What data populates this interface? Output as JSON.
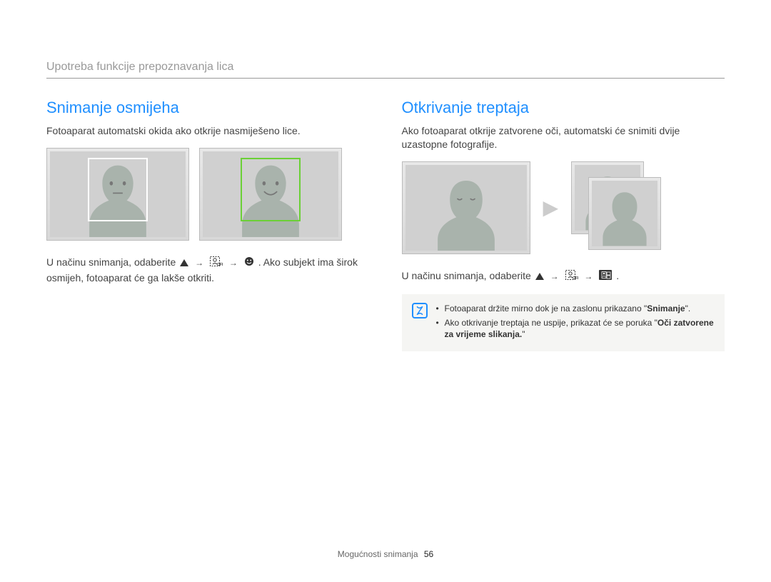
{
  "header": {
    "title": "Upotreba funkcije prepoznavanja lica"
  },
  "left": {
    "heading": "Snimanje osmijeha",
    "intro": "Fotoaparat automatski okida ako otkrije nasmiješeno lice.",
    "instruction_pre": "U načinu snimanja, odaberite ",
    "instruction_post": ". Ako subjekt ima širok osmijeh, fotoaparat će ga lakše otkriti.",
    "icons": {
      "a": "up-triangle",
      "b": "face-detection-off",
      "c": "smile-face"
    }
  },
  "right": {
    "heading": "Otkrivanje treptaja",
    "intro": "Ako fotoaparat otkrije zatvorene oči, automatski će snimiti dvije uzastopne fotografije.",
    "instruction_pre": "U načinu snimanja, odaberite ",
    "instruction_post": ".",
    "icons": {
      "a": "up-triangle",
      "b": "face-detection-off",
      "c": "blink-detection"
    },
    "notes": {
      "items": [
        {
          "pre": "Fotoaparat držite mirno dok je na zaslonu prikazano \"",
          "bold": "Snimanje",
          "post": "\"."
        },
        {
          "pre": "Ako otkrivanje treptaja ne uspije, prikazat će se poruka \"",
          "bold": "Oči zatvorene za vrijeme slikanja.",
          "post": "\""
        }
      ]
    }
  },
  "footer": {
    "section": "Mogućnosti snimanja",
    "page": "56"
  }
}
